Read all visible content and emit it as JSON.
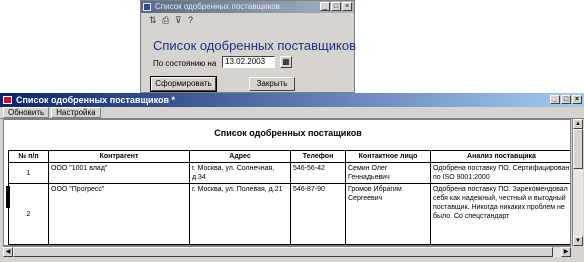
{
  "dialog": {
    "window_title": "Список одобренных поставщиков",
    "heading": "Список одобренных поставщиков",
    "date_label": "По состоянию на",
    "date_value": "13.02.2003",
    "form_button": "Сформировать",
    "close_button": "Закрыть"
  },
  "main": {
    "window_title": "Список одобренных поставщиков *",
    "menu": [
      "Обновить",
      "Настройка"
    ],
    "report_title": "Список одобренных постащиков",
    "columns": [
      "№ п/п",
      "Контрагент",
      "Адрес",
      "Телефон",
      "Контактное лицо",
      "Анализ поставщика"
    ],
    "rows": [
      {
        "num": "1",
        "contractor": "ООО \"1001 влад\"",
        "address": "г. Москва, ул. Солнечная, д.34",
        "phone": "546-56-42",
        "contact": "Семин Олег Геннадьевич",
        "analysis": "Одобрена поставку ПО. Сертифицирован по ISO 9001:2000"
      },
      {
        "num": "2",
        "contractor": "ООО \"Прогресс\"",
        "address": "г. Москва, ул. Полевая, д.21",
        "phone": "546-87-90",
        "contact": "Громов Ибрагим Сергеевич",
        "analysis": "Одобрена поставку ПО. Зарекомендовал себя как надежный, честный и выгодный поставщик. Никогда никаких проблем не было. Со спецстандарт"
      }
    ]
  }
}
